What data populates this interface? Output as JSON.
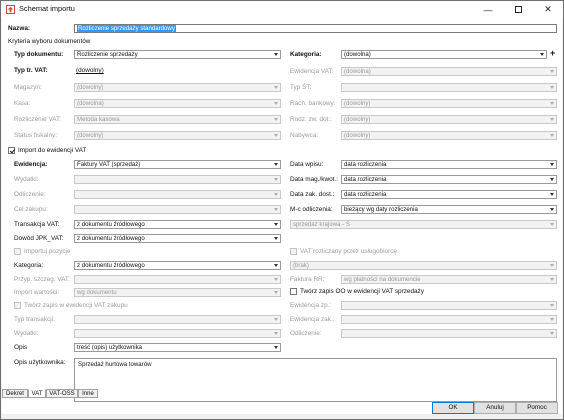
{
  "window": {
    "title": "Schemat importu",
    "icon": "import-schema-icon"
  },
  "name_label": "Nazwa:",
  "name_value": "Rozliczenie sprzedaży standardowy",
  "criteria_header": "Kryteria wyboru dokumentów",
  "left": {
    "typ_dok": {
      "label": "Typ dokumentu:",
      "value": "Rozliczenie sprzedaży"
    },
    "typ_vat": {
      "label": "Typ tr. VAT:",
      "value": "(dowolny)"
    },
    "magazyn": {
      "label": "Magazyn:",
      "value": "(dowolny)"
    },
    "kasa": {
      "label": "Kasa:",
      "value": "(dowolna)"
    },
    "rozliczenie_vat": {
      "label": "Rozliczenie VAT:",
      "value": "Metoda kasowa"
    },
    "status_fiskalny": {
      "label": "Status fiskalny:",
      "value": "(dowolny)"
    }
  },
  "right": {
    "kategoria": {
      "label": "Kategoria:",
      "value": "(dowolna)"
    },
    "ewidencja_vat": {
      "label": "Ewidencja VAT:",
      "value": "(dowolna)"
    },
    "typ_st": {
      "label": "Typ ŚT:",
      "value": ""
    },
    "rach_bankowy": {
      "label": "Rach. bankowy:",
      "value": "(dowolny)"
    },
    "rodz_zw_dot": {
      "label": "Rodz. zw. dot.:",
      "value": "(dowolny)"
    },
    "nabywca": {
      "label": "Nabywca:",
      "value": "(dowolny)"
    }
  },
  "import_vat": {
    "label": "Import do ewidencji VAT",
    "checked": true
  },
  "vat_left": {
    "ewidencja": {
      "label": "Ewidencja:",
      "value": "Faktury VAT (sprzedaż)"
    },
    "wydatki": {
      "label": "Wydatki:",
      "value": ""
    },
    "odliczenie": {
      "label": "Odliczenie:",
      "value": ""
    },
    "cel_zakupu": {
      "label": "Cel zakupu:",
      "value": ""
    },
    "transakcja_vat": {
      "label": "Transakcja VAT:",
      "value": "z dokumentu źródłowego"
    },
    "dowod_jpk": {
      "label": "Dowód JPK_VAT:",
      "value": "z dokumentu źródłowego"
    },
    "importuj_pozycje": "Importuj pozycje",
    "kategoria": {
      "label": "Kategoria:",
      "value": "z dokumentu źródłowego"
    },
    "przyp_szczeg": {
      "label": "Przyp. szczeg. VAT:",
      "value": ""
    },
    "import_wartosci": {
      "label": "Import wartości:",
      "value": "wg dokumentu"
    },
    "tworz_zapis_zakup": "Twórz zapis w ewidencji VAT zakupu",
    "typ_transakcji": {
      "label": "Typ transakcji:",
      "value": ""
    },
    "wydatki2": {
      "label": "Wydatki:",
      "value": ""
    },
    "opis": {
      "label": "Opis",
      "value": "treść (opis) użytkownika"
    },
    "opis_uzytkownika": {
      "label": "Opis użytkownika:",
      "value": "Sprzedaż hurtowa towarów"
    }
  },
  "vat_right": {
    "data_wpisu": {
      "label": "Data wpisu:",
      "value": "data rozliczenia"
    },
    "data_mag": {
      "label": "Data mag./kwot.:",
      "value": "data rozliczenia"
    },
    "data_zak": {
      "label": "Data zak. dost.:",
      "value": "data rozliczenia"
    },
    "mc_odliczenia": {
      "label": "M-c odliczenia:",
      "value": "bieżący wg daty rozliczenia"
    },
    "sprzedaz_krajowa": {
      "value": "sprzedaż krajowa - S"
    },
    "vat_rozliczany": "VAT rozliczany przez usługobiorcę",
    "brak": {
      "value": "(brak)"
    },
    "faktura_rr": {
      "label": "Faktura RR:",
      "value": "wg płatności na dokumencie"
    },
    "tworz_zapis_oo": "Twórz zapis OO w ewidencji VAT sprzedaży",
    "ewidencja_zp": {
      "label": "Ewidencja zp.:",
      "value": ""
    },
    "ewidencja_zak": {
      "label": "Ewidencja zak.:",
      "value": ""
    },
    "odliczenie": {
      "label": "Odliczenie:",
      "value": ""
    }
  },
  "tabs": [
    "Dekret",
    "VAT",
    "VAT-OSS",
    "Inne"
  ],
  "active_tab": "VAT",
  "buttons": {
    "ok": "OK",
    "cancel": "Anuluj",
    "help": "Pomoc"
  },
  "accent_color": "#0078d7",
  "selection_color": "#3399ff"
}
